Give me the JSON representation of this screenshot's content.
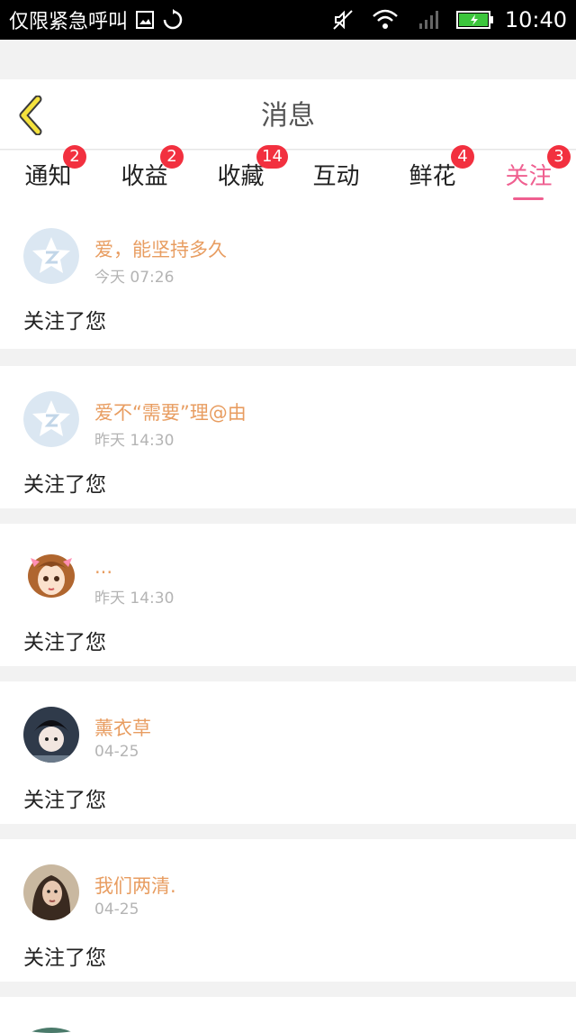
{
  "status_bar": {
    "carrier": "仅限紧急呼叫",
    "time": "10:40"
  },
  "header": {
    "title": "消息"
  },
  "tabs": [
    {
      "label": "通知",
      "badge": "2"
    },
    {
      "label": "收益",
      "badge": "2"
    },
    {
      "label": "收藏",
      "badge": "14"
    },
    {
      "label": "互动",
      "badge": ""
    },
    {
      "label": "鲜花",
      "badge": "4"
    },
    {
      "label": "关注",
      "badge": "3",
      "active": true
    }
  ],
  "items": [
    {
      "name": "爱，能坚持多久",
      "time": "今天 07:26",
      "message": "关注了您",
      "avatar": "default-qzone-avatar"
    },
    {
      "name": "爱不“需要”理@由",
      "time": "昨天 14:30",
      "message": "关注了您",
      "avatar": "default-qzone-avatar"
    },
    {
      "name": "...",
      "time": "昨天 14:30",
      "message": "关注了您",
      "avatar": "cartoon-girl-avatar"
    },
    {
      "name": "薰衣草",
      "time": "04-25",
      "message": "关注了您",
      "avatar": "photo-avatar"
    },
    {
      "name": "我们两清.",
      "time": "04-25",
      "message": "关注了您",
      "avatar": "photo-avatar"
    }
  ],
  "colors": {
    "accent_pink": "#ef5f90",
    "badge_red": "#f2303f",
    "name_orange": "#e89d61",
    "timestamp_gray": "#b4b4b4",
    "back_arrow_yellow": "#f5e23d"
  }
}
